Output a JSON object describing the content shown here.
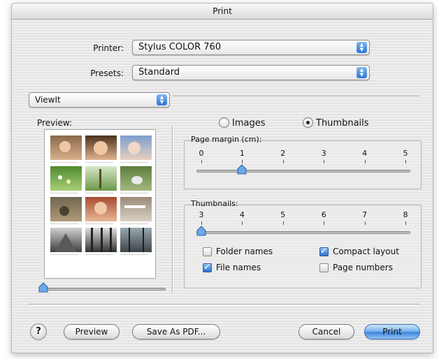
{
  "window": {
    "title": "Print"
  },
  "printer": {
    "label": "Printer:",
    "value": "Stylus COLOR 760"
  },
  "presets": {
    "label": "Presets:",
    "value": "Standard"
  },
  "panel_select": {
    "value": "ViewIt"
  },
  "preview": {
    "label": "Preview:",
    "zoom_level": 0.0
  },
  "mode": {
    "images_label": "Images",
    "thumbnails_label": "Thumbnails",
    "selected": "Thumbnails"
  },
  "page_margin": {
    "title": "Page margin (cm):",
    "ticks": [
      "0",
      "1",
      "2",
      "3",
      "4",
      "5"
    ],
    "value": 1
  },
  "thumbnails": {
    "title": "Thumbnails:",
    "ticks": [
      "3",
      "4",
      "5",
      "6",
      "7",
      "8"
    ],
    "value": 3
  },
  "options": {
    "folder_names": {
      "label": "Folder names",
      "checked": false
    },
    "compact_layout": {
      "label": "Compact layout",
      "checked": true
    },
    "file_names": {
      "label": "File names",
      "checked": true
    },
    "page_numbers": {
      "label": "Page numbers",
      "checked": false
    }
  },
  "buttons": {
    "help": "?",
    "preview": "Preview",
    "save_pdf": "Save As PDF...",
    "cancel": "Cancel",
    "print": "Print"
  },
  "colors": {
    "accent": "#3f86dc",
    "stripe_light": "#efefef",
    "stripe_dark": "#e4e4e4"
  }
}
